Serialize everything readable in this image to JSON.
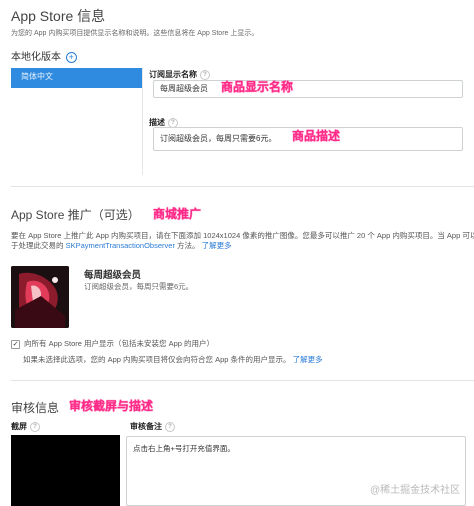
{
  "info": {
    "title": "App Store 信息",
    "subtitle": "为您的 App 内购买项目提供显示名称和说明。这些信息将在 App Store 上显示。",
    "localization_label": "本地化版本",
    "localization_selected": "简体中文",
    "display_name_label": "订阅显示名称",
    "display_name_value": "每周超级会员",
    "display_name_annotation": "商品显示名称",
    "desc_label": "描述",
    "desc_value": "订阅超级会员，每周只需要6元。",
    "desc_annotation": "商品描述"
  },
  "promo": {
    "title": "App Store 推广（可选）",
    "annotation": "商城推广",
    "desc_line1": "要在 App Store 上推广此 App 内购买项目，请在下面添加 1024x1024 像素的推广图像。您最多可以推广 20 个 App 内购买项目。当 App 可以从 App Store 上下载时，",
    "desc_line2_prefix": "于处理此交易的",
    "desc_link": "SKPaymentTransactionObserver",
    "desc_line2_suffix": "方法。",
    "learn_more": "了解更多",
    "product_name": "每周超级会员",
    "product_desc": "订阅超级会员，每周只需要6元。",
    "checkbox_label": "向所有 App Store 用户显示（包括未安装您 App 的用户）",
    "checkbox_note": "如果未选择此选项，您的 App 内购买项目将仅会向符合您 App 条件的用户显示。",
    "learn_more2": "了解更多"
  },
  "review": {
    "title": "审核信息",
    "annotation": "审核截屏与描述",
    "screenshot_label": "截屏",
    "notes_label": "审核备注",
    "notes_value": "点击右上角+号打开充值界面。",
    "watermark": "@稀土掘金技术社区"
  },
  "colors": {
    "accent": "#2a7bd6",
    "annotation": "#ff2a88",
    "selected_bg": "#2f8be0"
  }
}
